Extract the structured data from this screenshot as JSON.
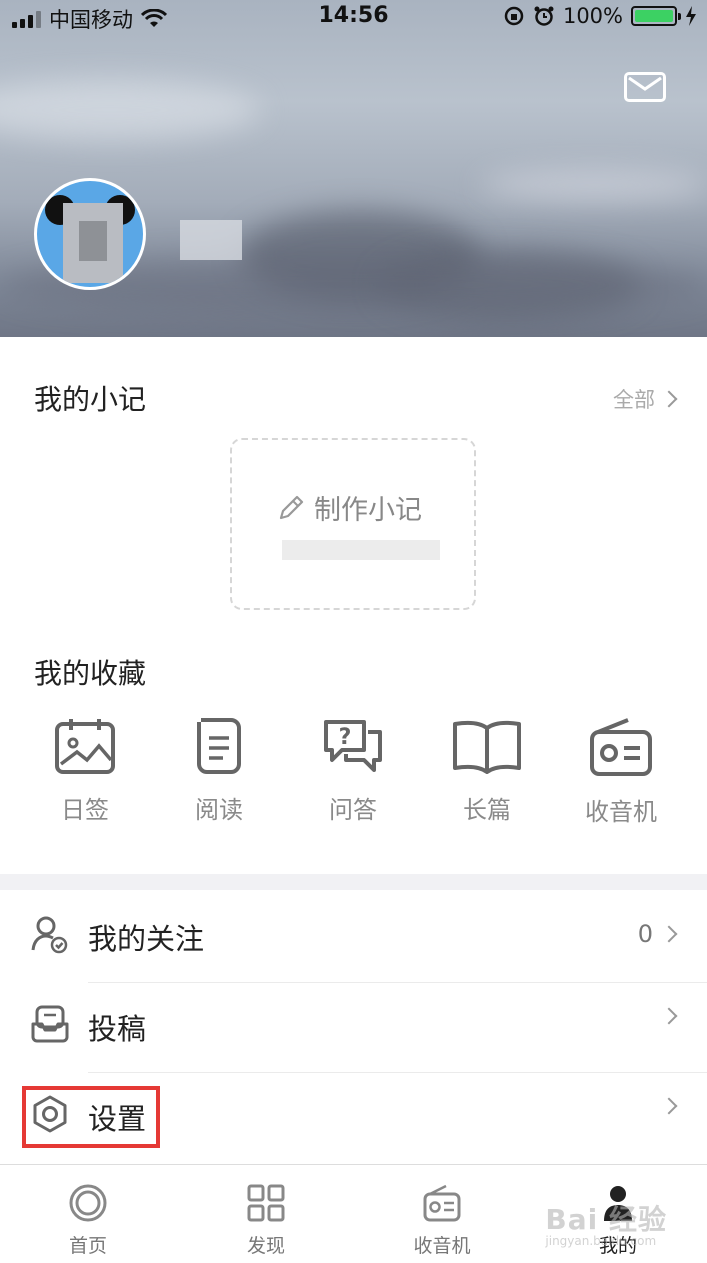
{
  "status_bar": {
    "carrier": "中国移动",
    "time": "14:56",
    "battery": "100%"
  },
  "notes": {
    "title": "我的小记",
    "more_label": "全部",
    "make_label": "制作小记"
  },
  "favorites": {
    "title": "我的收藏",
    "items": [
      {
        "label": "日签",
        "icon": "calendar-image-icon"
      },
      {
        "label": "阅读",
        "icon": "document-icon"
      },
      {
        "label": "问答",
        "icon": "qa-bubble-icon"
      },
      {
        "label": "长篇",
        "icon": "book-icon"
      },
      {
        "label": "收音机",
        "icon": "radio-icon"
      }
    ]
  },
  "menu": {
    "items": [
      {
        "label": "我的关注",
        "value": "0",
        "icon": "user-check-icon"
      },
      {
        "label": "投稿",
        "value": "",
        "icon": "submit-icon"
      },
      {
        "label": "设置",
        "value": "",
        "icon": "hexagon-settings-icon"
      }
    ]
  },
  "tabs": [
    {
      "label": "首页",
      "icon": "home-ring-icon",
      "active": false
    },
    {
      "label": "发现",
      "icon": "grid-icon",
      "active": false
    },
    {
      "label": "收音机",
      "icon": "radio-icon",
      "active": false
    },
    {
      "label": "我的",
      "icon": "person-icon",
      "active": true
    }
  ],
  "watermark": {
    "text": "Bai 经验",
    "sub": "jingyan.baidu.com"
  },
  "colors": {
    "highlight": "#e53935",
    "battery": "#3cd163"
  }
}
